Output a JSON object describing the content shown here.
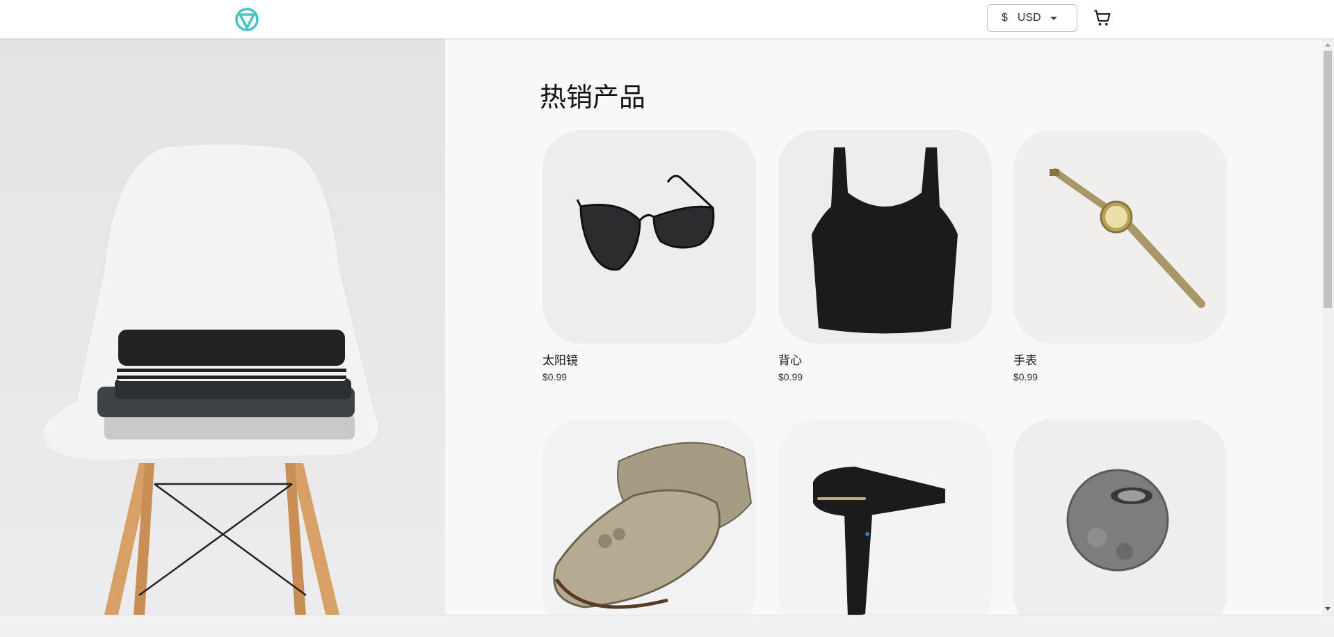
{
  "header": {
    "logo": "store-logo-icon",
    "currency": {
      "symbol": "$",
      "code": "USD"
    },
    "cart_icon": "shopping-cart-icon",
    "brand_color": "#46c4c4"
  },
  "hero": {
    "image": "white-chair-with-folded-clothes"
  },
  "section": {
    "title": "热销产品",
    "products": [
      {
        "name": "太阳镜",
        "price": "$0.99",
        "image": "sunglasses"
      },
      {
        "name": "背心",
        "price": "$0.99",
        "image": "tank-top"
      },
      {
        "name": "手表",
        "price": "$0.99",
        "image": "watch"
      },
      {
        "name": "",
        "price": "",
        "image": "loafers"
      },
      {
        "name": "",
        "price": "",
        "image": "hairdryer"
      },
      {
        "name": "",
        "price": "",
        "image": "candle-holder"
      }
    ]
  }
}
